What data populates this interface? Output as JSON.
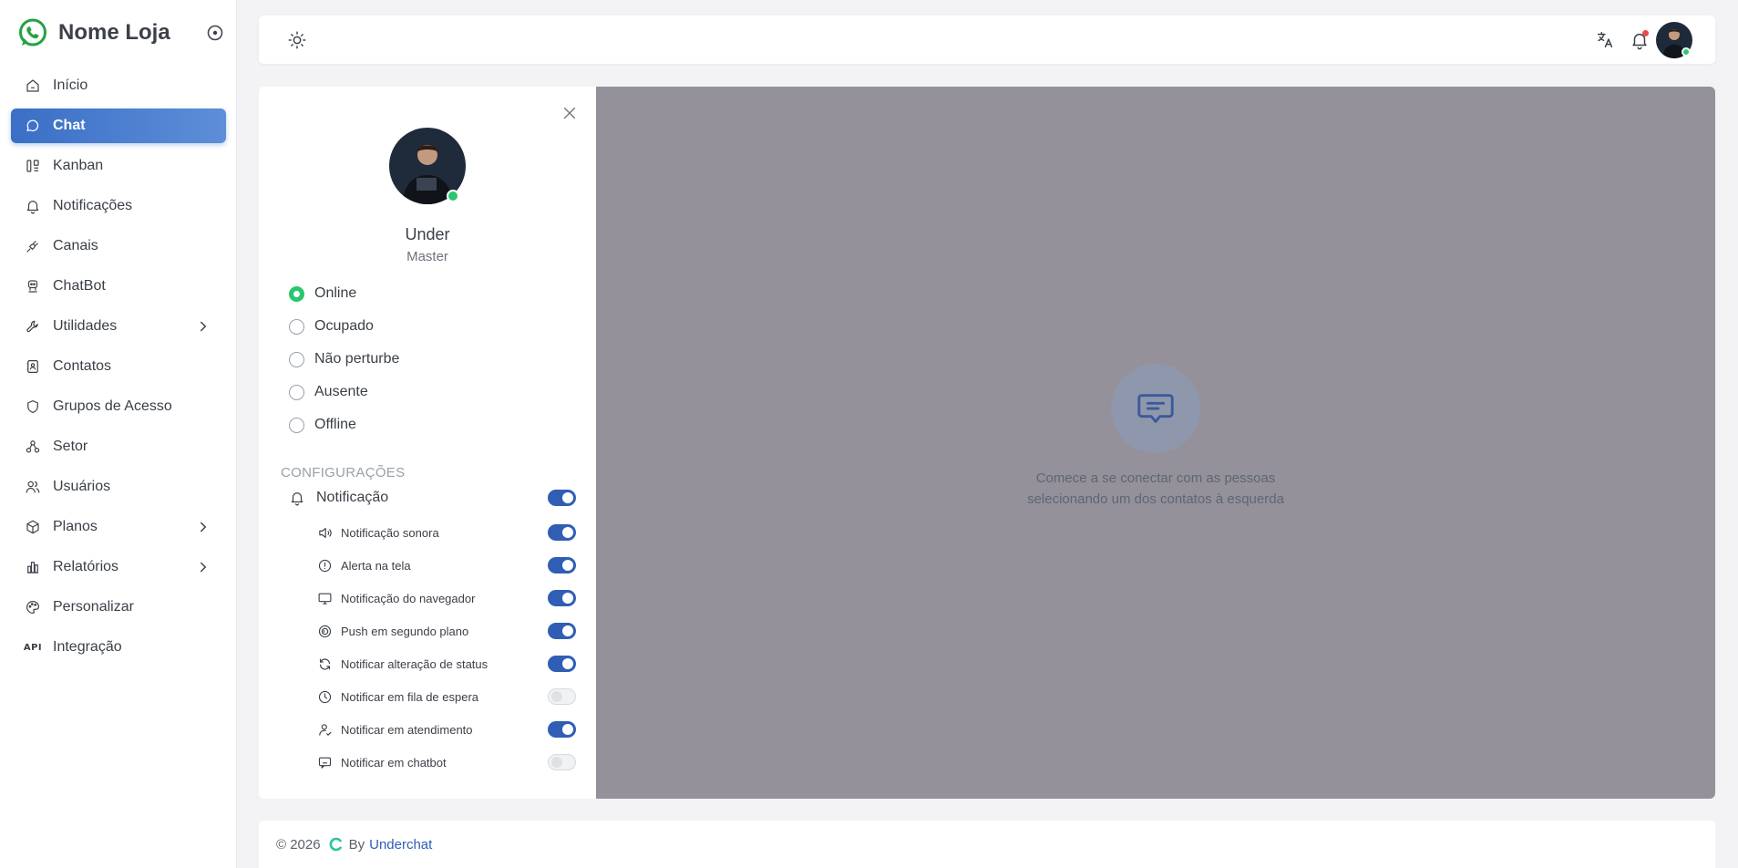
{
  "brand": {
    "name": "Nome Loja"
  },
  "sidebar": {
    "items": [
      {
        "label": "Início",
        "icon": "home-icon"
      },
      {
        "label": "Chat",
        "icon": "chat-icon",
        "active": true
      },
      {
        "label": "Kanban",
        "icon": "kanban-icon"
      },
      {
        "label": "Notificações",
        "icon": "bell-icon"
      },
      {
        "label": "Canais",
        "icon": "plug-icon"
      },
      {
        "label": "ChatBot",
        "icon": "robot-icon"
      },
      {
        "label": "Utilidades",
        "icon": "wrench-icon",
        "submenu": true
      },
      {
        "label": "Contatos",
        "icon": "contacts-icon"
      },
      {
        "label": "Grupos de Acesso",
        "icon": "shield-icon"
      },
      {
        "label": "Setor",
        "icon": "sector-icon"
      },
      {
        "label": "Usuários",
        "icon": "users-icon"
      },
      {
        "label": "Planos",
        "icon": "box-icon",
        "submenu": true
      },
      {
        "label": "Relatórios",
        "icon": "chart-icon",
        "submenu": true
      },
      {
        "label": "Personalizar",
        "icon": "palette-icon"
      },
      {
        "label": "Integração",
        "icon": "api-icon",
        "icon_text": "API"
      }
    ]
  },
  "topbar": {
    "icons": [
      "sun-icon",
      "translate-icon",
      "bell-icon",
      "user-avatar"
    ]
  },
  "profile": {
    "name": "Under",
    "role": "Master",
    "statuses": [
      {
        "label": "Online",
        "checked": true
      },
      {
        "label": "Ocupado",
        "checked": false
      },
      {
        "label": "Não perturbe",
        "checked": false
      },
      {
        "label": "Ausente",
        "checked": false
      },
      {
        "label": "Offline",
        "checked": false
      }
    ],
    "settings_title": "CONFIGURAÇÕES",
    "notification": {
      "label": "Notificação",
      "enabled": true
    },
    "options": [
      {
        "label": "Notificação sonora",
        "icon": "speaker-icon",
        "enabled": true
      },
      {
        "label": "Alerta na tela",
        "icon": "alert-icon",
        "enabled": true
      },
      {
        "label": "Notificação do navegador",
        "icon": "monitor-icon",
        "enabled": true
      },
      {
        "label": "Push em segundo plano",
        "icon": "push-icon",
        "enabled": true
      },
      {
        "label": "Notificar alteração de status",
        "icon": "refresh-icon",
        "enabled": true
      },
      {
        "label": "Notificar em fila de espera",
        "icon": "clock-icon",
        "enabled": false
      },
      {
        "label": "Notificar em atendimento",
        "icon": "user-check-icon",
        "enabled": true
      },
      {
        "label": "Notificar em chatbot",
        "icon": "chatbot-icon",
        "enabled": false
      }
    ]
  },
  "chat_empty": {
    "line1": "Comece a se conectar com as pessoas",
    "line2": "selecionando um dos contatos à esquerda"
  },
  "footer": {
    "copyright": "© 2026",
    "by": "By",
    "link": "Underchat"
  },
  "colors": {
    "accent": "#3a6fc6",
    "toggle_on": "#2f5eb4",
    "online": "#28c76f",
    "overlay": "#94919b"
  }
}
